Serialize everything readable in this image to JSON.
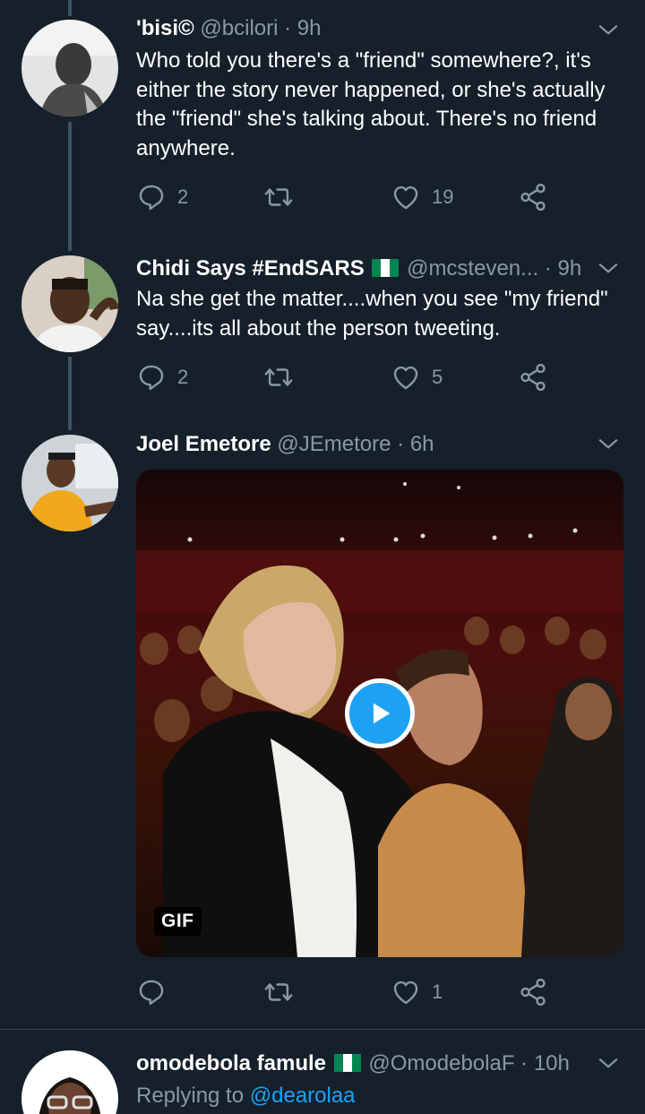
{
  "colors": {
    "background": "#15202b",
    "secondary_text": "#8899a6",
    "accent_blue": "#1da1f2",
    "divider": "#38444d"
  },
  "tweets": [
    {
      "name": "'bisi©",
      "handle": "@bcilori",
      "time": "· 9h",
      "text": "Who told you there's a \"friend\" somewhere?, it's either the story never happened, or she's actually the \"friend\" she's talking about. There's no friend anywhere.",
      "replies": "2",
      "retweets": "",
      "likes": "19"
    },
    {
      "name": "Chidi Says #EndSARS",
      "flag": "nigeria-flag",
      "handle": "@mcsteven...",
      "time": "· 9h",
      "text": "Na she get the matter....when you see \"my friend\" say....its all about the person tweeting.",
      "replies": "2",
      "retweets": "",
      "likes": "5"
    },
    {
      "name": "Joel Emetore",
      "handle": "@JEmetore",
      "time": "· 6h",
      "media_badge": "GIF",
      "replies": "",
      "retweets": "",
      "likes": "1"
    },
    {
      "name": "omodebola famule",
      "flag": "nigeria-flag",
      "handle": "@OmodebolaF",
      "time": "· 10h",
      "reply_prefix": "Replying to",
      "reply_mention": "@dearolaa"
    }
  ]
}
